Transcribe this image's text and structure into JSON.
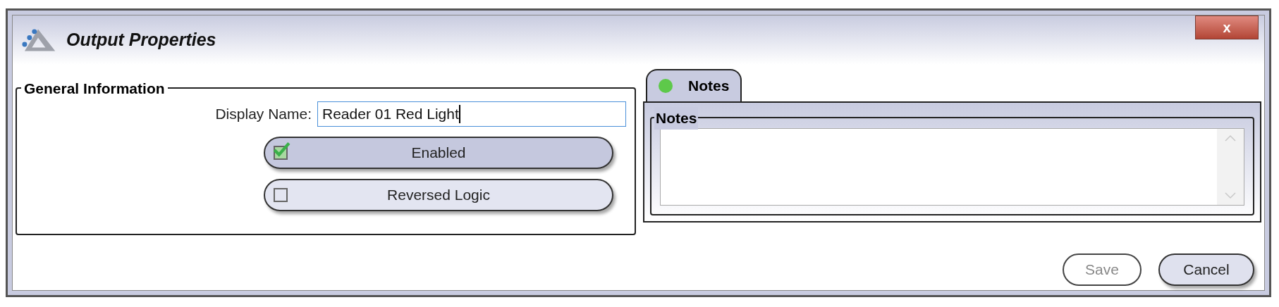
{
  "window": {
    "title": "Output Properties",
    "close_label": "x"
  },
  "general_information": {
    "legend": "General Information",
    "display_name": {
      "label": "Display Name:",
      "value": "Reader 01 Red Light",
      "focused": true
    },
    "toggles": [
      {
        "label": "Enabled",
        "checked": true
      },
      {
        "label": "Reversed Logic",
        "checked": false
      }
    ]
  },
  "tabs": [
    {
      "label": "Notes",
      "selected": true,
      "color": "#5ec94a"
    }
  ],
  "notes": {
    "legend": "Notes"
  },
  "buttons": [
    {
      "label": "Save",
      "disabled": true
    },
    {
      "label": "Cancel",
      "disabled": false
    }
  ]
}
